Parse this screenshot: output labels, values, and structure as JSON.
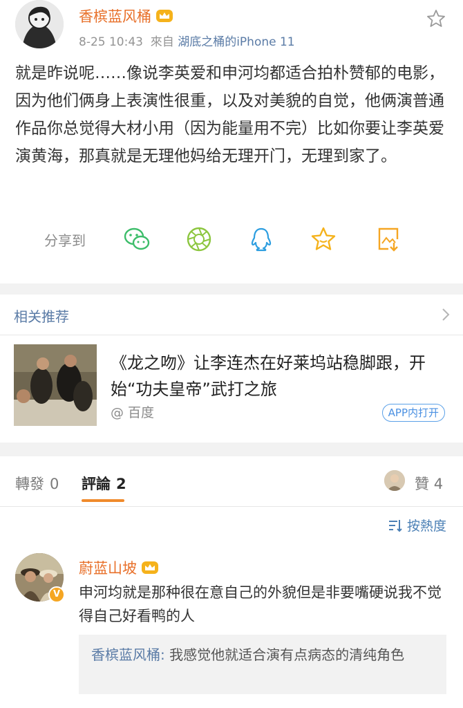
{
  "post": {
    "author": "香槟蓝风桶",
    "time": "8-25 10:43",
    "source_prefix": "來自",
    "source": "湖底之桶的iPhone 11",
    "body": "就是昨说呢……像说李英爱和申河均都适合拍朴赞郁的电影，因为他们俩身上表演性很重，以及对美貌的自觉，他俩演普通作品你总觉得大材小用（因为能量用不完）比如你要让李英爱演黄海，那真就是无理他妈给无理开门，无理到家了。",
    "icons": {
      "favorite": "star-outline-icon",
      "crown": "crown-icon"
    }
  },
  "share": {
    "label": "分享到",
    "targets": [
      {
        "name": "wechat",
        "icon": "wechat-icon",
        "color": "#3dbd6a"
      },
      {
        "name": "moments",
        "icon": "moments-icon",
        "color": "#8cc63f"
      },
      {
        "name": "qq",
        "icon": "qq-icon",
        "color": "#2d9ee0"
      },
      {
        "name": "favorite",
        "icon": "star-icon",
        "color": "#f5b21b"
      },
      {
        "name": "save-image",
        "icon": "save-image-icon",
        "color": "#f5a623"
      }
    ]
  },
  "related": {
    "heading": "相关推荐",
    "title": "《龙之吻》让李连杰在好莱坞站稳脚跟，开始“功夫皇帝”武打之旅",
    "source": "@ 百度",
    "open_app": "APP内打开"
  },
  "comments": {
    "tabs": [
      {
        "label": "轉發",
        "count": "0"
      },
      {
        "label": "評論",
        "count": "2"
      }
    ],
    "likes_label": "贊",
    "likes_count": "4",
    "sort_label": "按熱度",
    "items": [
      {
        "author": "蔚蓝山坡",
        "badge": "V",
        "text": "申河均就是那种很在意自己的外貌但是非要嘴硬说我不觉得自己好看鸭的人",
        "reply": {
          "name": "香槟蓝风桶:",
          "text": " 我感觉他就适合演有点病态的清纯角色"
        }
      }
    ]
  },
  "colors": {
    "accent": "#e8702a",
    "link": "#5a7ba6",
    "tab_underline": "#f08a2c"
  }
}
